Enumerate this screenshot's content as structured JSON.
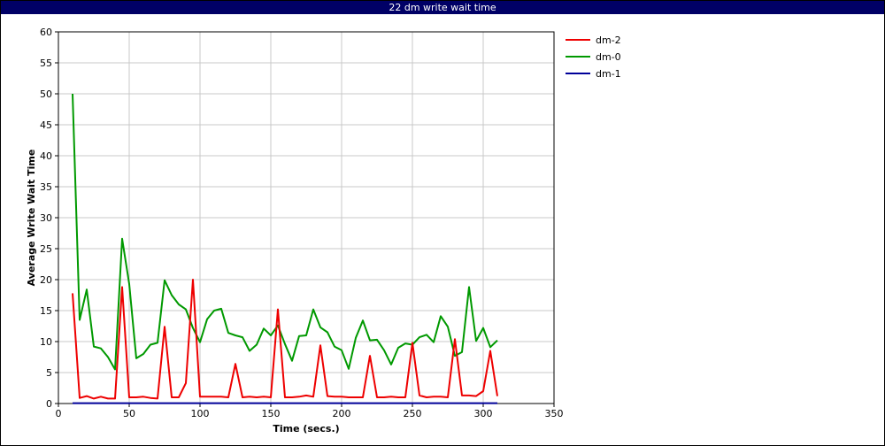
{
  "window": {
    "title": "22 dm write wait time"
  },
  "chart_data": {
    "type": "line",
    "title": "22 dm write wait time",
    "xlabel": "Time (secs.)",
    "ylabel": "Average Write Wait Time",
    "xlim": [
      0,
      350
    ],
    "ylim": [
      0,
      60
    ],
    "xticks": [
      0,
      50,
      100,
      150,
      200,
      250,
      300,
      350
    ],
    "yticks": [
      0,
      5,
      10,
      15,
      20,
      25,
      30,
      35,
      40,
      45,
      50,
      55,
      60
    ],
    "grid": true,
    "legend_position": "right",
    "x": [
      10,
      15,
      20,
      25,
      30,
      35,
      40,
      45,
      50,
      55,
      60,
      65,
      70,
      75,
      80,
      85,
      90,
      95,
      100,
      105,
      110,
      115,
      120,
      125,
      130,
      135,
      140,
      145,
      150,
      155,
      160,
      165,
      170,
      175,
      180,
      185,
      190,
      195,
      200,
      205,
      210,
      215,
      220,
      225,
      230,
      235,
      240,
      245,
      250,
      255,
      260,
      265,
      270,
      275,
      280,
      285,
      290,
      295,
      300,
      305,
      310
    ],
    "series": [
      {
        "name": "dm-2",
        "color": "#ee0000",
        "values": [
          17.8,
          0.9,
          1.2,
          0.8,
          1.1,
          0.8,
          0.8,
          18.8,
          1.0,
          1.0,
          1.1,
          0.9,
          0.8,
          12.4,
          1.0,
          1.0,
          3.3,
          20.0,
          1.1,
          1.1,
          1.1,
          1.1,
          1.0,
          6.4,
          1.0,
          1.1,
          1.0,
          1.1,
          1.0,
          15.2,
          1.0,
          1.0,
          1.1,
          1.3,
          1.1,
          9.4,
          1.2,
          1.1,
          1.1,
          1.0,
          1.0,
          1.0,
          7.7,
          1.0,
          1.0,
          1.1,
          1.0,
          1.0,
          9.8,
          1.3,
          1.0,
          1.1,
          1.1,
          1.0,
          10.4,
          1.3,
          1.3,
          1.2,
          2.0,
          8.5,
          1.2
        ]
      },
      {
        "name": "dm-0",
        "color": "#009900",
        "values": [
          50.0,
          13.5,
          18.4,
          9.2,
          8.9,
          7.5,
          5.5,
          26.6,
          19.3,
          7.3,
          8.0,
          9.5,
          9.8,
          19.9,
          17.5,
          16.0,
          15.2,
          12.2,
          9.9,
          13.6,
          15.0,
          15.3,
          11.4,
          11.0,
          10.7,
          8.5,
          9.5,
          12.1,
          11.0,
          12.6,
          9.6,
          6.9,
          10.9,
          11.0,
          15.2,
          12.3,
          11.5,
          9.2,
          8.6,
          5.6,
          10.6,
          13.4,
          10.2,
          10.3,
          8.6,
          6.3,
          9.0,
          9.7,
          9.5,
          10.7,
          11.1,
          9.9,
          14.1,
          12.4,
          7.7,
          8.3,
          18.8,
          10.1,
          12.2,
          9.1,
          10.2
        ]
      },
      {
        "name": "dm-1",
        "color": "#000099",
        "values": [
          0.05,
          0.05,
          0.05,
          0.05,
          0.05,
          0.05,
          0.05,
          0.05,
          0.05,
          0.05,
          0.05,
          0.05,
          0.05,
          0.05,
          0.05,
          0.05,
          0.05,
          0.05,
          0.05,
          0.05,
          0.05,
          0.05,
          0.05,
          0.05,
          0.05,
          0.05,
          0.05,
          0.05,
          0.05,
          0.05,
          0.05,
          0.05,
          0.05,
          0.05,
          0.05,
          0.05,
          0.05,
          0.05,
          0.05,
          0.05,
          0.05,
          0.05,
          0.05,
          0.05,
          0.05,
          0.05,
          0.05,
          0.05,
          0.05,
          0.05,
          0.05,
          0.05,
          0.05,
          0.05,
          0.05,
          0.05,
          0.05,
          0.05,
          0.05,
          0.05,
          0.05
        ]
      }
    ]
  }
}
